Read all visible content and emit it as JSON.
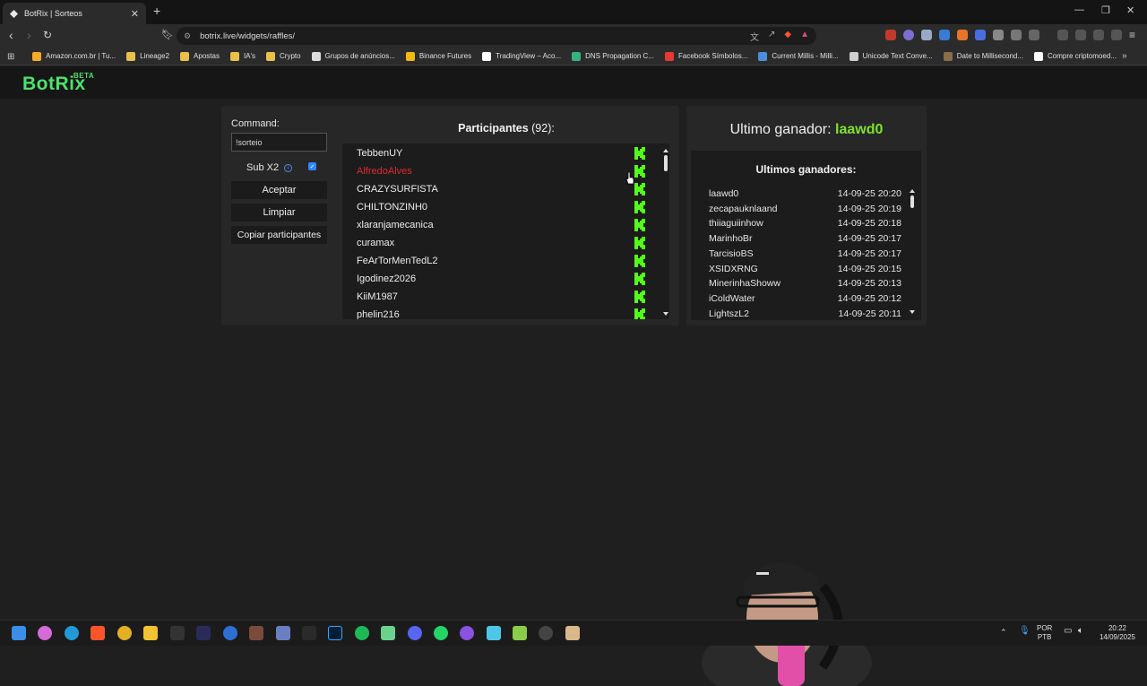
{
  "browser": {
    "tab_title": "BotRix | Sorteos",
    "url": "botrix.live/widgets/raffles/",
    "bookmarks": [
      {
        "label": "Amazon.com.br | Tu...",
        "color": "#f7a928"
      },
      {
        "label": "Lineage2",
        "color": "#e8c14a"
      },
      {
        "label": "Apostas",
        "color": "#e8c14a"
      },
      {
        "label": "IA's",
        "color": "#e8c14a"
      },
      {
        "label": "Crypto",
        "color": "#e8c14a"
      },
      {
        "label": "Grupos de anúncios...",
        "color": "#dcdcdc"
      },
      {
        "label": "Binance Futures",
        "color": "#f0b90b"
      },
      {
        "label": "TradingView – Aco...",
        "color": "#ffffff"
      },
      {
        "label": "DNS Propagation C...",
        "color": "#36b37e"
      },
      {
        "label": "Facebook Símbolos...",
        "color": "#e53935"
      },
      {
        "label": "Current Millis - Milli...",
        "color": "#4a90d9"
      },
      {
        "label": "Unicode Text Conve...",
        "color": "#cfcfcf"
      },
      {
        "label": "Date to Millisecond...",
        "color": "#8a6d4a"
      },
      {
        "label": "Compre criptomoed...",
        "color": "#ffffff"
      }
    ]
  },
  "header": {
    "logo": "BotRix",
    "logo_badge": "BETA"
  },
  "command": {
    "label": "Command:",
    "value": "!sorteio"
  },
  "sub_x2": {
    "label": "Sub X2",
    "checked": true
  },
  "buttons": {
    "accept": "Aceptar",
    "clear": "Limpiar",
    "copy": "Copiar participantes"
  },
  "participants": {
    "title": "Participantes",
    "count": "(92):",
    "items": [
      {
        "name": "TebbenUY",
        "highlight": false
      },
      {
        "name": "AlfredoAlves",
        "highlight": true
      },
      {
        "name": "CRAZYSURFISTA",
        "highlight": false
      },
      {
        "name": "CHILTONZINH0",
        "highlight": false
      },
      {
        "name": "xlaranjamecanica",
        "highlight": false
      },
      {
        "name": "curamax",
        "highlight": false
      },
      {
        "name": "FeArTorMenTedL2",
        "highlight": false
      },
      {
        "name": "Igodinez2026",
        "highlight": false
      },
      {
        "name": "KiiM1987",
        "highlight": false
      },
      {
        "name": "phelin216",
        "highlight": false
      }
    ]
  },
  "last_winner": {
    "label": "Ultimo ganador:",
    "name": "laawd0"
  },
  "winners": {
    "title": "Ultimos ganadores:",
    "items": [
      {
        "name": "laawd0",
        "time": "14-09-25 20:20"
      },
      {
        "name": "zecapauknlaand",
        "time": "14-09-25 20:19"
      },
      {
        "name": "thiiaguiinhow",
        "time": "14-09-25 20:18"
      },
      {
        "name": "MarinhoBr",
        "time": "14-09-25 20:17"
      },
      {
        "name": "TarcisioBS",
        "time": "14-09-25 20:17"
      },
      {
        "name": "XSIDXRNG",
        "time": "14-09-25 20:15"
      },
      {
        "name": "MinerinhaShoww",
        "time": "14-09-25 20:13"
      },
      {
        "name": "iColdWater",
        "time": "14-09-25 20:12"
      },
      {
        "name": "LightszL2",
        "time": "14-09-25 20:11"
      }
    ]
  },
  "taskbar": {
    "lang": "POR",
    "layout": "PTB",
    "time": "20:22",
    "date": "14/09/2025"
  },
  "colors": {
    "accent": "#4ee06e",
    "kick_green": "#53fc18",
    "winner_green": "#7fe034",
    "highlight_red": "#e0282f"
  }
}
